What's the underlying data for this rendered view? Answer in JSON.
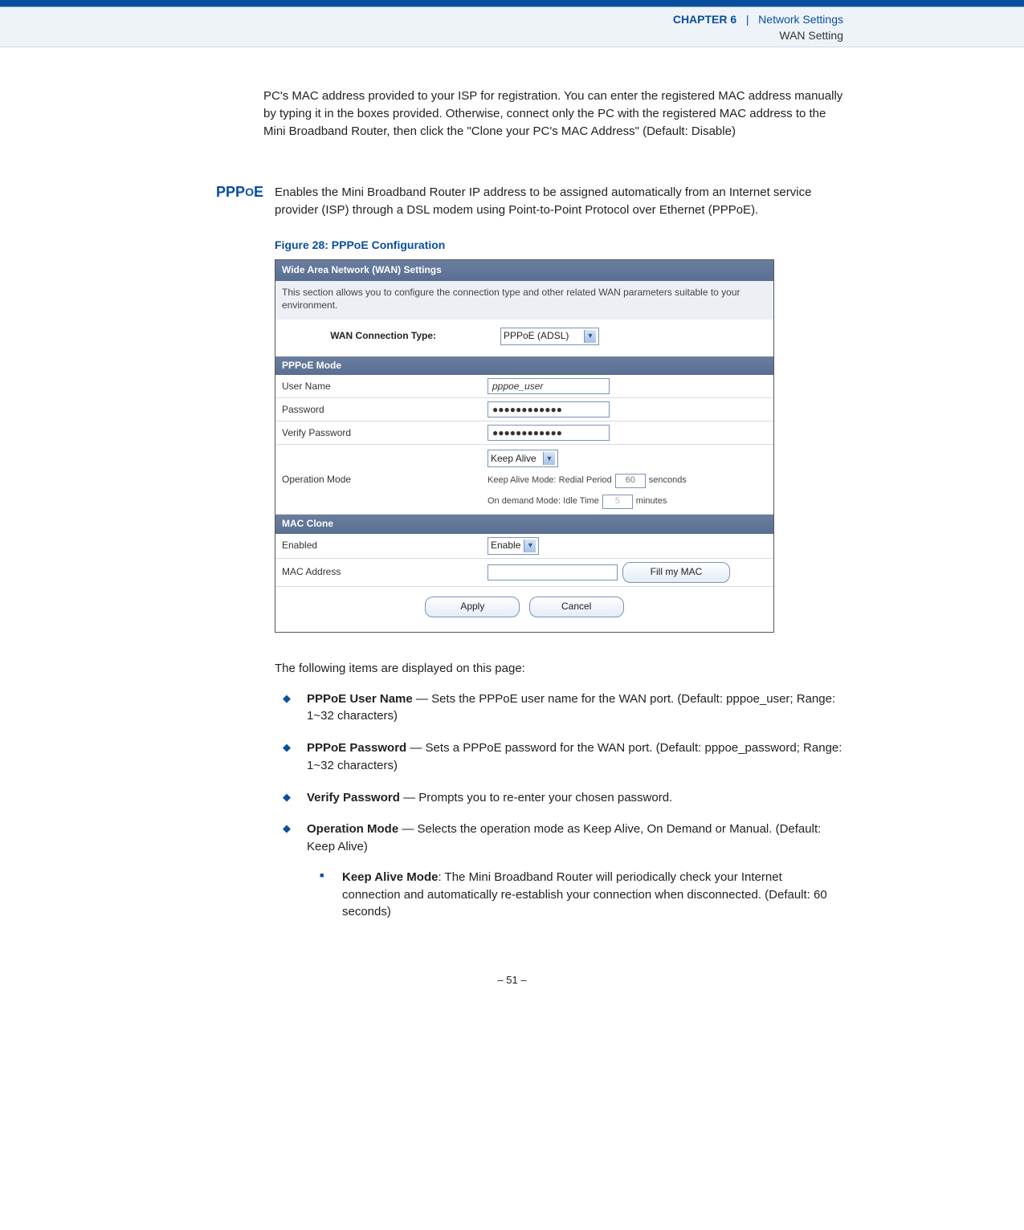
{
  "header": {
    "chapter_label": "CHAPTER 6",
    "separator": "|",
    "title": "Network Settings",
    "subtitle": "WAN Setting"
  },
  "intro_paragraph": "PC's MAC address provided to your ISP for registration. You can enter the registered MAC address manually by typing it in the boxes provided. Otherwise, connect only the PC with the registered MAC address to the Mini Broadband Router, then click the \"Clone your PC's MAC Address\" (Default: Disable)",
  "pppoe": {
    "label": "PPPOE",
    "desc": "Enables the Mini Broadband Router IP address to be assigned automatically from an Internet service provider (ISP) through a DSL modem using Point-to-Point Protocol over Ethernet (PPPoE).",
    "figure_caption": "Figure 28:  PPPoE Configuration"
  },
  "screenshot": {
    "title": "Wide Area Network (WAN) Settings",
    "desc": "This section allows you to configure the connection type and other related WAN parameters suitable to your environment.",
    "wan_label": "WAN Connection Type:",
    "wan_value": "PPPoE (ADSL)",
    "section_pppoe": "PPPoE Mode",
    "row_user": "User Name",
    "val_user": "pppoe_user",
    "row_pass": "Password",
    "val_pass": "●●●●●●●●●●●●",
    "row_verify": "Verify Password",
    "val_verify": "●●●●●●●●●●●●",
    "row_op": "Operation Mode",
    "op_select": "Keep Alive",
    "op_keep_text1": "Keep Alive Mode: Redial Period",
    "op_keep_val": "60",
    "op_keep_text2": "senconds",
    "op_demand_text1": "On demand Mode: Idle Time",
    "op_demand_val": "5",
    "op_demand_text2": "minutes",
    "section_mac": "MAC Clone",
    "row_enabled": "Enabled",
    "val_enabled": "Enable",
    "row_macaddr": "MAC Address",
    "btn_fillmac": "Fill my MAC",
    "btn_apply": "Apply",
    "btn_cancel": "Cancel"
  },
  "post_intro": "The following items are displayed on this page:",
  "bullets": {
    "b1_title": "PPPoE User Name",
    "b1_text": " — Sets the PPPoE user name for the WAN port. (Default: pppoe_user; Range: 1~32 characters)",
    "b2_title": "PPPoE Password",
    "b2_text": " — Sets a PPPoE password for the WAN port. (Default: pppoe_password; Range: 1~32 characters)",
    "b3_title": "Verify Password",
    "b3_text": " — Prompts you to re-enter your chosen password.",
    "b4_title": "Operation Mode",
    "b4_text": " — Selects the operation mode as Keep Alive, On Demand or Manual. (Default: Keep Alive)",
    "b4_sub_title": "Keep Alive Mode",
    "b4_sub_text": ": The Mini Broadband Router will periodically check your Internet connection and automatically re-establish your connection when disconnected. (Default: 60 seconds)"
  },
  "footer": "–  51  –"
}
